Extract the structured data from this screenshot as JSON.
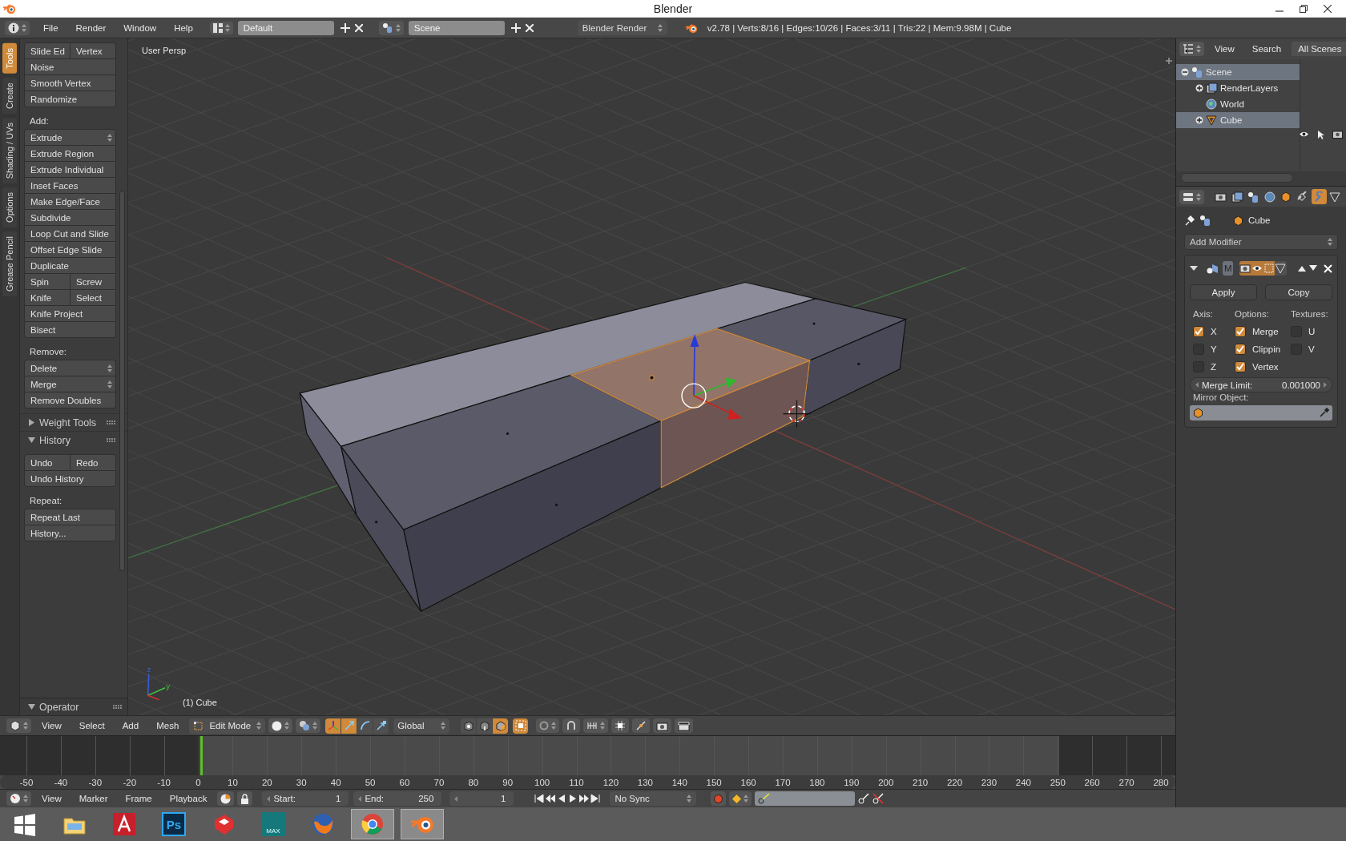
{
  "window": {
    "title": "Blender"
  },
  "top_bar": {
    "menus": [
      "File",
      "Render",
      "Window",
      "Help"
    ],
    "layout": "Default",
    "scene": "Scene",
    "engine": "Blender Render",
    "stats": "v2.78 | Verts:8/16 | Edges:10/26 | Faces:3/11 | Tris:22 | Mem:9.98M | Cube"
  },
  "tool_tabs": [
    {
      "label": "Tools",
      "selected": true
    },
    {
      "label": "Create",
      "selected": false
    },
    {
      "label": "Shading / UVs",
      "selected": false
    },
    {
      "label": "Options",
      "selected": false
    },
    {
      "label": "Grease Pencil",
      "selected": false
    }
  ],
  "tool_shelf": [
    {
      "kind": "group",
      "rows": [
        {
          "labels": [
            "Slide Ed",
            "Vertex"
          ],
          "dropdown": false
        },
        {
          "labels": [
            "Noise"
          ],
          "dropdown": false
        },
        {
          "labels": [
            "Smooth Vertex"
          ],
          "dropdown": false
        },
        {
          "labels": [
            "Randomize"
          ],
          "dropdown": false
        }
      ]
    },
    {
      "kind": "heading",
      "label": "Add:"
    },
    {
      "kind": "group",
      "rows": [
        {
          "labels": [
            "Extrude"
          ],
          "dropdown": true
        },
        {
          "labels": [
            "Extrude Region"
          ],
          "dropdown": false
        },
        {
          "labels": [
            "Extrude Individual"
          ],
          "dropdown": false
        },
        {
          "labels": [
            "Inset Faces"
          ],
          "dropdown": false
        },
        {
          "labels": [
            "Make Edge/Face"
          ],
          "dropdown": false
        },
        {
          "labels": [
            "Subdivide"
          ],
          "dropdown": false
        },
        {
          "labels": [
            "Loop Cut and Slide"
          ],
          "dropdown": false
        },
        {
          "labels": [
            "Offset Edge Slide"
          ],
          "dropdown": false
        },
        {
          "labels": [
            "Duplicate"
          ],
          "dropdown": false
        },
        {
          "labels": [
            "Spin",
            "Screw"
          ],
          "dropdown": false
        },
        {
          "labels": [
            "Knife",
            "Select"
          ],
          "dropdown": false
        },
        {
          "labels": [
            "Knife Project"
          ],
          "dropdown": false
        },
        {
          "labels": [
            "Bisect"
          ],
          "dropdown": false
        }
      ]
    },
    {
      "kind": "heading",
      "label": "Remove:"
    },
    {
      "kind": "group",
      "rows": [
        {
          "labels": [
            "Delete"
          ],
          "dropdown": true
        },
        {
          "labels": [
            "Merge"
          ],
          "dropdown": true
        },
        {
          "labels": [
            "Remove Doubles"
          ],
          "dropdown": false
        }
      ]
    },
    {
      "kind": "panel",
      "label": "Weight Tools",
      "expanded": false
    },
    {
      "kind": "panel",
      "label": "History",
      "expanded": true
    },
    {
      "kind": "group",
      "rows": [
        {
          "labels": [
            "Undo",
            "Redo"
          ],
          "dropdown": false
        },
        {
          "labels": [
            "Undo History"
          ],
          "dropdown": false
        }
      ]
    },
    {
      "kind": "heading",
      "label": "Repeat:"
    },
    {
      "kind": "group",
      "rows": [
        {
          "labels": [
            "Repeat Last"
          ],
          "dropdown": false
        },
        {
          "labels": [
            "History..."
          ],
          "dropdown": false
        }
      ]
    }
  ],
  "operator_panel": {
    "label": "Operator",
    "expanded": true
  },
  "viewport": {
    "view_name": "User Persp",
    "object_label": "(1) Cube",
    "axis_labels": [
      "z",
      "y"
    ]
  },
  "header_3d": {
    "menus": [
      "View",
      "Select",
      "Add",
      "Mesh"
    ],
    "mode": "Edit Mode",
    "orientation": "Global",
    "manipulators": [
      {
        "kind": "axes",
        "on": true
      },
      {
        "kind": "translate",
        "on": true
      },
      {
        "kind": "rotate",
        "on": false
      },
      {
        "kind": "scale",
        "on": false
      }
    ],
    "select_modes": [
      {
        "kind": "vertex",
        "selected": false
      },
      {
        "kind": "edge",
        "selected": false
      },
      {
        "kind": "face",
        "selected": true
      }
    ],
    "occlude": true
  },
  "timeline": {
    "ruler": [
      "-50",
      "-40",
      "-30",
      "-20",
      "-10",
      "0",
      "10",
      "20",
      "30",
      "40",
      "50",
      "60",
      "70",
      "80",
      "90",
      "100",
      "110",
      "120",
      "130",
      "140",
      "150",
      "160",
      "170",
      "180",
      "190",
      "200",
      "210",
      "220",
      "230",
      "240",
      "250",
      "260",
      "270",
      "280"
    ],
    "menus": [
      "View",
      "Marker",
      "Frame",
      "Playback"
    ],
    "start": {
      "label": "Start:",
      "value": "1"
    },
    "end": {
      "label": "End:",
      "value": "250"
    },
    "current_frame": "1",
    "sync": "No Sync"
  },
  "outliner": {
    "menus": [
      "View",
      "Search"
    ],
    "filter": "All Scenes",
    "tree": [
      {
        "label": "Scene",
        "expanded": true,
        "selected": true,
        "children": [
          {
            "label": "RenderLayers",
            "expanded": false,
            "selected": false
          },
          {
            "label": "World",
            "selected": false
          },
          {
            "label": "Cube",
            "expanded": false,
            "selected": true
          }
        ]
      }
    ]
  },
  "properties": {
    "context_tabs": [
      {
        "kind": "render",
        "selected": false
      },
      {
        "kind": "layers",
        "selected": false
      },
      {
        "kind": "scene",
        "selected": false
      },
      {
        "kind": "world",
        "selected": false
      },
      {
        "kind": "object",
        "selected": false
      },
      {
        "kind": "constraints",
        "selected": false
      },
      {
        "kind": "modifiers",
        "selected": true
      },
      {
        "kind": "data",
        "selected": false
      }
    ],
    "object": "Cube",
    "add_modifier": "Add Modifier",
    "modifier": {
      "name": "M",
      "expanded": true,
      "toggles": [
        {
          "kind": "render",
          "on": true
        },
        {
          "kind": "view",
          "on": true
        },
        {
          "kind": "editmode",
          "on": true
        },
        {
          "kind": "cage",
          "on": false
        }
      ],
      "buttons": [
        "Apply",
        "Copy"
      ],
      "columns": [
        {
          "heading": "Axis:",
          "options": [
            {
              "label": "X",
              "checked": true
            },
            {
              "label": "Y",
              "checked": false
            },
            {
              "label": "Z",
              "checked": false
            }
          ]
        },
        {
          "heading": "Options:",
          "options": [
            {
              "label": "Merge",
              "checked": true
            },
            {
              "label": "Clippin",
              "checked": true
            },
            {
              "label": "Vertex",
              "checked": true
            }
          ]
        },
        {
          "heading": "Textures:",
          "options": [
            {
              "label": "U",
              "checked": false
            },
            {
              "label": "V",
              "checked": false
            }
          ]
        }
      ],
      "merge_limit": {
        "label": "Merge Limit:",
        "value": "0.001000"
      },
      "mirror_object": "Mirror Object:"
    }
  },
  "taskbar": [
    {
      "kind": "start",
      "selected": false
    },
    {
      "kind": "folder",
      "selected": false
    },
    {
      "kind": "cad",
      "selected": false
    },
    {
      "kind": "ps",
      "text": "Ps",
      "selected": false
    },
    {
      "kind": "sketch",
      "selected": false
    },
    {
      "kind": "max",
      "text": "MAX",
      "selected": false
    },
    {
      "kind": "fox",
      "selected": false
    },
    {
      "kind": "chrome",
      "selected": true
    },
    {
      "kind": "blender",
      "selected": true
    }
  ]
}
